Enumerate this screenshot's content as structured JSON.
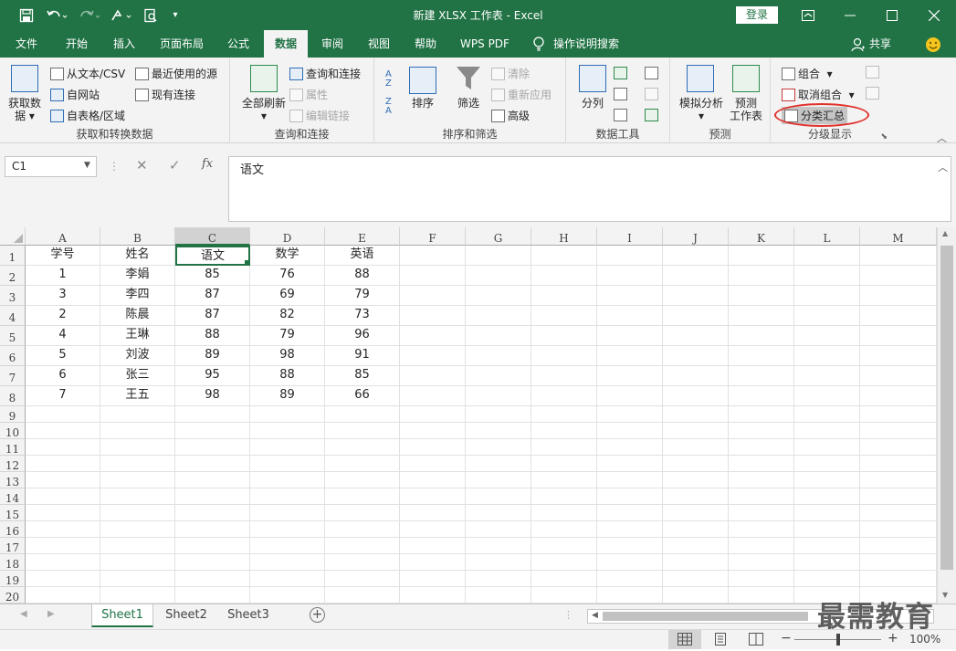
{
  "titlebar": {
    "title": "新建 XLSX 工作表 - Excel",
    "login_label": "登录",
    "icons": [
      "save-icon",
      "undo-icon",
      "redo-icon",
      "format-painter-icon",
      "print-preview-icon",
      "customize-icon"
    ]
  },
  "tabs": [
    {
      "label": "文件"
    },
    {
      "label": "开始"
    },
    {
      "label": "插入"
    },
    {
      "label": "页面布局"
    },
    {
      "label": "公式"
    },
    {
      "label": "数据",
      "active": true
    },
    {
      "label": "审阅"
    },
    {
      "label": "视图"
    },
    {
      "label": "帮助"
    },
    {
      "label": "WPS PDF"
    },
    {
      "label": "操作说明搜索"
    }
  ],
  "share_label": "共享",
  "ribbon": {
    "get_data": {
      "big_label_1": "获取数",
      "big_label_2": "据",
      "from_text": "从文本/CSV",
      "from_web": "自网站",
      "from_table": "自表格/区域",
      "recent": "最近使用的源",
      "existing": "现有连接",
      "group_label": "获取和转换数据"
    },
    "queries": {
      "refresh_all": "全部刷新",
      "queries_conn": "查询和连接",
      "properties": "属性",
      "edit_links": "编辑链接",
      "group_label": "查询和连接"
    },
    "sort_filter": {
      "sort": "排序",
      "filter": "筛选",
      "clear": "清除",
      "reapply": "重新应用",
      "advanced": "高级",
      "group_label": "排序和筛选"
    },
    "data_tools": {
      "split": "分列",
      "group_label": "数据工具"
    },
    "forecast": {
      "what_if": "模拟分析",
      "sheet_1": "预测",
      "sheet_2": "工作表",
      "group_label": "预测"
    },
    "outline": {
      "group": "组合",
      "ungroup": "取消组合",
      "subtotal": "分类汇总",
      "group_label": "分级显示"
    }
  },
  "formula_bar": {
    "name_box": "C1",
    "cancel": "✕",
    "enter": "✓",
    "fx": "fx",
    "content": "语文"
  },
  "sheet": {
    "columns": [
      "A",
      "B",
      "C",
      "D",
      "E",
      "F",
      "G",
      "H",
      "I",
      "J",
      "K",
      "L",
      "M"
    ],
    "selected_column": "C",
    "selected_cell": "C1",
    "rows": [
      [
        "学号",
        "姓名",
        "语文",
        "数学",
        "英语"
      ],
      [
        "1",
        "李娟",
        "85",
        "76",
        "88"
      ],
      [
        "3",
        "李四",
        "87",
        "69",
        "79"
      ],
      [
        "2",
        "陈晨",
        "87",
        "82",
        "73"
      ],
      [
        "4",
        "王琳",
        "88",
        "79",
        "96"
      ],
      [
        "5",
        "刘波",
        "89",
        "98",
        "91"
      ],
      [
        "6",
        "张三",
        "95",
        "88",
        "85"
      ],
      [
        "7",
        "王五",
        "98",
        "89",
        "66"
      ]
    ],
    "row_count": 20
  },
  "sheet_tabs": [
    {
      "label": "Sheet1",
      "active": true
    },
    {
      "label": "Sheet2"
    },
    {
      "label": "Sheet3"
    }
  ],
  "status": {
    "zoom": "100%",
    "minus": "−",
    "plus": "+"
  },
  "watermark": "最需教育",
  "colors": {
    "accent": "#217346",
    "highlight_circle": "#e0302a"
  }
}
